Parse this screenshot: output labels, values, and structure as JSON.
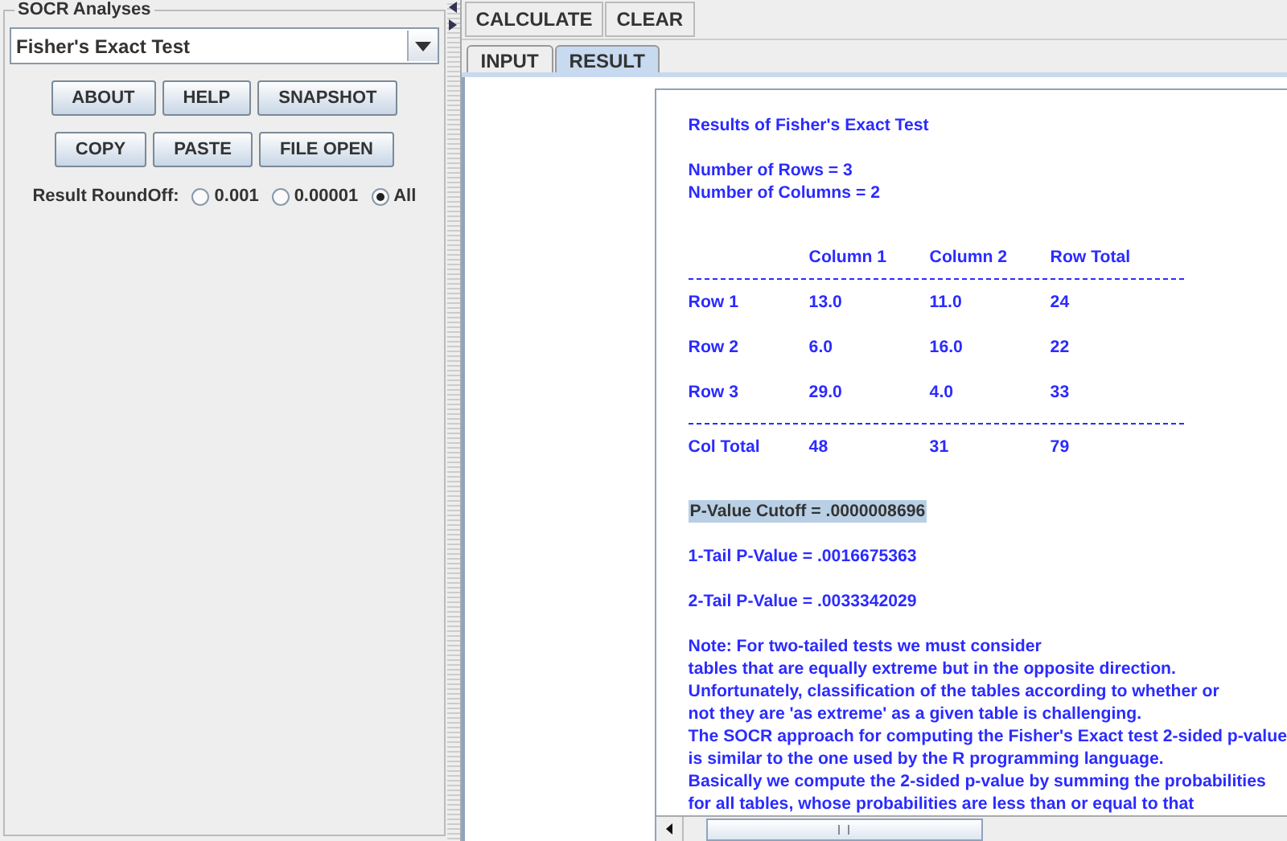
{
  "panel": {
    "title": "SOCR Analyses",
    "analysis": "Fisher's Exact Test",
    "buttons": [
      [
        "ABOUT",
        "HELP",
        "SNAPSHOT"
      ],
      [
        "COPY",
        "PASTE",
        "FILE OPEN"
      ]
    ],
    "roundoff": {
      "label": "Result RoundOff:",
      "options": [
        {
          "label": "0.001",
          "selected": false
        },
        {
          "label": "0.00001",
          "selected": false
        },
        {
          "label": "All",
          "selected": true
        }
      ]
    }
  },
  "toolbar": {
    "buttons": [
      "CALCULATE",
      "CLEAR"
    ]
  },
  "tabs": [
    {
      "label": "INPUT",
      "selected": false
    },
    {
      "label": "RESULT",
      "selected": true
    }
  ],
  "result": {
    "title": "Results of Fisher's Exact Test",
    "info": [
      "Number of Rows = 3",
      "Number of Columns = 2"
    ],
    "table": {
      "columns": [
        "",
        "Column 1",
        "Column 2",
        "Row Total"
      ],
      "rows": [
        [
          "Row 1",
          "13.0",
          "11.0",
          "24"
        ],
        [
          "Row 2",
          "6.0",
          "16.0",
          "22"
        ],
        [
          "Row 3",
          "29.0",
          "4.0",
          "33"
        ]
      ],
      "total": [
        "Col Total",
        "48",
        "31",
        "79"
      ]
    },
    "cutoff": {
      "text": "P-Value Cutoff = .0000008696",
      "selected": true
    },
    "p_values": [
      "1-Tail P-Value = .0016675363",
      "2-Tail P-Value = .0033342029"
    ],
    "note": [
      "Note: For two-tailed tests we must consider",
      "tables that are equally extreme but in the opposite direction.",
      "Unfortunately, classification of the tables according to whether or",
      "not they are 'as extreme' as a given table is challenging.",
      "The SOCR approach for computing the Fisher's Exact test 2-sided p-value",
      "is similar to the one used by the R programming language.",
      "Basically we compute the 2-sided p-value by summing the probabilities",
      "for all tables, whose probabilities are less than or equal to that"
    ]
  }
}
